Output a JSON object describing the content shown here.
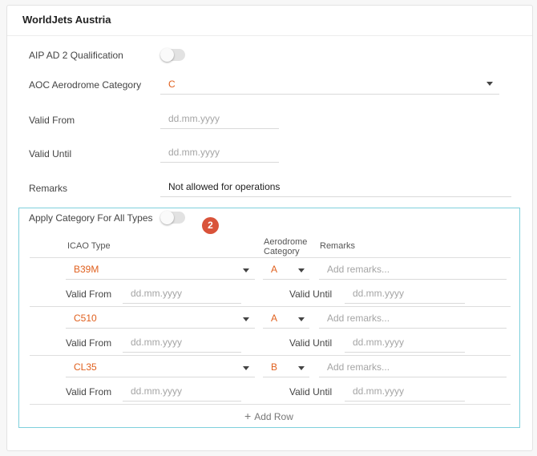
{
  "card": {
    "title": "WorldJets Austria"
  },
  "aip": {
    "label": "AIP AD 2 Qualification"
  },
  "aoc": {
    "label": "AOC Aerodrome Category",
    "value": "C"
  },
  "valid_from": {
    "label": "Valid From",
    "placeholder": "dd.mm.yyyy"
  },
  "valid_until": {
    "label": "Valid Until",
    "placeholder": "dd.mm.yyyy"
  },
  "remarks": {
    "label": "Remarks",
    "value": "Not allowed for operations"
  },
  "apply_all": {
    "label": "Apply Category For All Types"
  },
  "step_badge": "2",
  "table": {
    "headers": {
      "icao": "ICAO Type",
      "aerodrome_line1": "Aerodrome",
      "aerodrome_line2": "Category",
      "remarks": "Remarks"
    },
    "rows": [
      {
        "icao": "B39M",
        "category": "A",
        "remarks_placeholder": "Add remarks...",
        "valid_from_label": "Valid From",
        "valid_from_placeholder": "dd.mm.yyyy",
        "valid_until_label": "Valid Until",
        "valid_until_placeholder": "dd.mm.yyyy"
      },
      {
        "icao": "C510",
        "category": "A",
        "remarks_placeholder": "Add remarks...",
        "valid_from_label": "Valid From",
        "valid_from_placeholder": "dd.mm.yyyy",
        "valid_until_label": "Valid Until",
        "valid_until_placeholder": "dd.mm.yyyy"
      },
      {
        "icao": "CL35",
        "category": "B",
        "remarks_placeholder": "Add remarks...",
        "valid_from_label": "Valid From",
        "valid_from_placeholder": "dd.mm.yyyy",
        "valid_until_label": "Valid Until",
        "valid_until_placeholder": "dd.mm.yyyy"
      }
    ],
    "add_row": "Add Row"
  },
  "colors": {
    "accent": "#e0601e",
    "panel_border": "#7fd0dc",
    "badge": "#d9533a"
  },
  "icons": {
    "dropdown": "caret-down-icon",
    "add": "plus-icon"
  }
}
